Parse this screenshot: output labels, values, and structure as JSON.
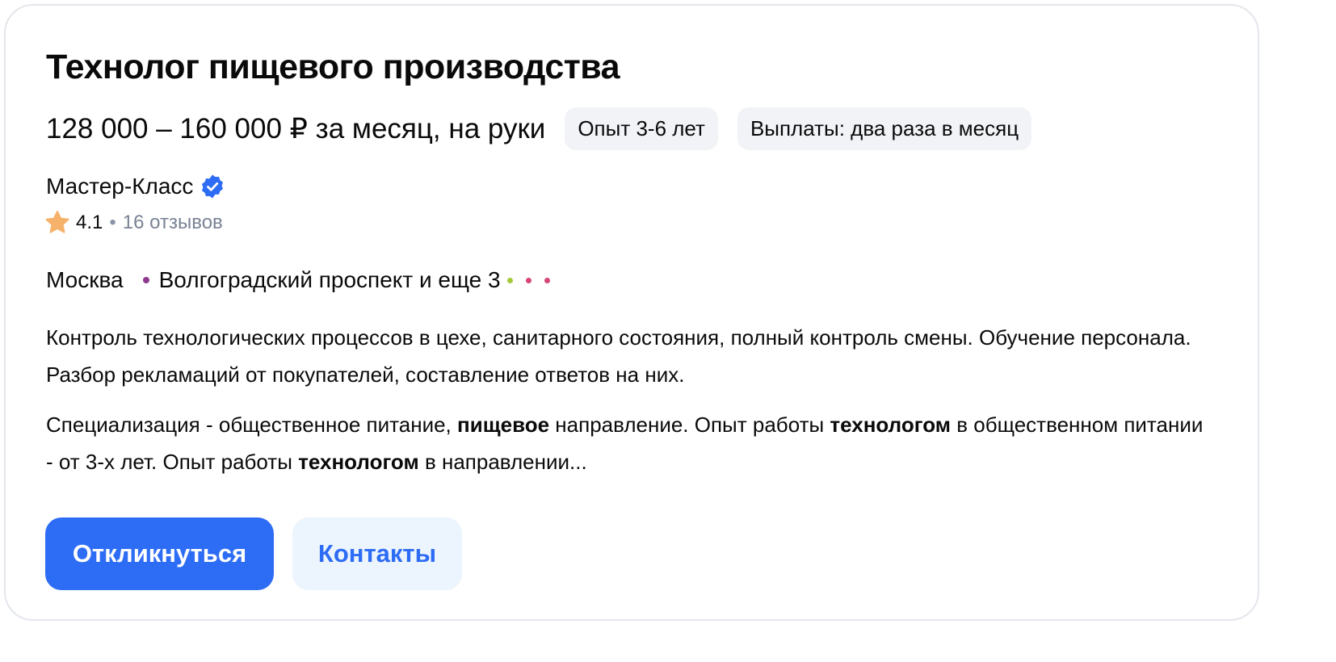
{
  "vacancy": {
    "title": "Технолог пищевого производства",
    "salary": "128 000 – 160 000 ₽ за месяц, на руки",
    "tags": [
      "Опыт 3-6 лет",
      "Выплаты: два раза в месяц"
    ]
  },
  "company": {
    "name": "Мастер-Класс",
    "verified_icon": "verified-badge-icon",
    "rating": "4.1",
    "rating_separator": "•",
    "reviews": "16 отзывов"
  },
  "location": {
    "city": "Москва",
    "metro": "Волгоградский проспект и еще 3",
    "metro_line_colors": [
      "#8e3a8f",
      "#a3c93a",
      "#d6457a",
      "#d6457a"
    ]
  },
  "description": {
    "p1": "Контроль технологических процессов в цехе, санитарного состояния, полный контроль смены. Обучение персонала. Разбор рекламаций от покупателей, составление ответов на них.",
    "p2_parts": [
      "Специализация - общественное питание, ",
      "пищевое",
      " направление. Опыт работы ",
      "технологом",
      " в общественном питании - от 3-х лет. Опыт работы ",
      "технологом",
      " в направлении..."
    ]
  },
  "actions": {
    "respond_label": "Откликнуться",
    "contacts_label": "Контакты"
  },
  "colors": {
    "accent": "#2d6cf5",
    "secondary_bg": "#ecf4fd",
    "chip_bg": "#f1f3f7",
    "star": "#f6b26b"
  }
}
